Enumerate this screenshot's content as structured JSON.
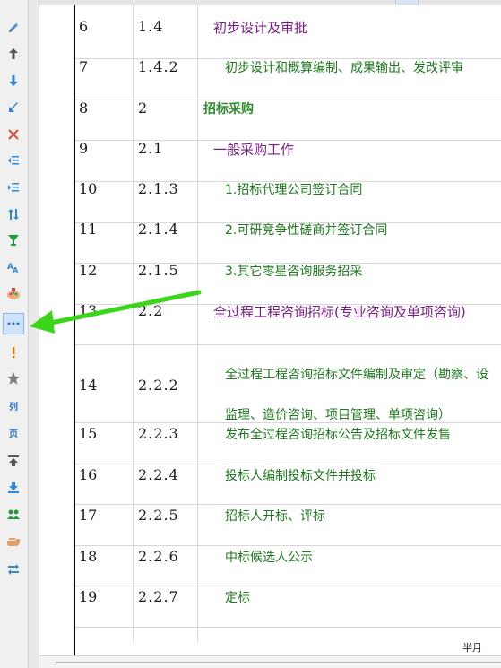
{
  "colors": {
    "summary_green": "#2e8b2e",
    "phase_purple": "#7a1e86",
    "task_green": "#1e7a1e",
    "annotation_arrow": "#3ad61a"
  },
  "toolbar": [
    {
      "name": "edit-pencil-icon"
    },
    {
      "name": "move-up-icon"
    },
    {
      "name": "move-down-icon"
    },
    {
      "name": "indent-arrow-icon"
    },
    {
      "name": "delete-icon"
    },
    {
      "name": "outdent-icon"
    },
    {
      "name": "indent-icon"
    },
    {
      "name": "swap-vertical-icon"
    },
    {
      "name": "filter-cup-icon"
    },
    {
      "name": "font-size-icon"
    },
    {
      "name": "palette-icon"
    },
    {
      "name": "more-dots-icon"
    },
    {
      "name": "exclamation-icon"
    },
    {
      "name": "star-icon"
    },
    {
      "name": "column-icon",
      "text": "列"
    },
    {
      "name": "page-icon",
      "text": "页"
    },
    {
      "name": "move-to-top-icon"
    },
    {
      "name": "download-icon"
    },
    {
      "name": "users-icon"
    },
    {
      "name": "hand-point-icon"
    },
    {
      "name": "switch-icon"
    }
  ],
  "rows": [
    {
      "seq": "6",
      "wbs": "1.4",
      "name": "初步设计及审批",
      "kind": "phase"
    },
    {
      "seq": "7",
      "wbs": "1.4.2",
      "name": "初步设计和概算编制、成果输出、发改评审",
      "kind": "task"
    },
    {
      "seq": "8",
      "wbs": "2",
      "name": "招标采购",
      "kind": "summary"
    },
    {
      "seq": "9",
      "wbs": "2.1",
      "name": "一般采购工作",
      "kind": "phase"
    },
    {
      "seq": "10",
      "wbs": "2.1.3",
      "name": "1.招标代理公司签订合同",
      "kind": "task"
    },
    {
      "seq": "11",
      "wbs": "2.1.4",
      "name": "2.可研竞争性磋商并签订合同",
      "kind": "task"
    },
    {
      "seq": "12",
      "wbs": "2.1.5",
      "name": "3.其它零星咨询服务招采",
      "kind": "task"
    },
    {
      "seq": "13",
      "wbs": "2.2",
      "name": "全过程工程咨询招标(专业咨询及单项咨询)",
      "kind": "phase"
    },
    {
      "seq": "14",
      "wbs": "2.2.2",
      "name": "全过程工程咨询招标文件编制及审定（勘察、设",
      "name2": "监理、造价咨询、项目管理、单项咨询）",
      "kind": "task"
    },
    {
      "seq": "15",
      "wbs": "2.2.3",
      "name": "发布全过程咨询招标公告及招标文件发售",
      "kind": "task"
    },
    {
      "seq": "16",
      "wbs": "2.2.4",
      "name": "投标人编制投标文件并投标",
      "kind": "task"
    },
    {
      "seq": "17",
      "wbs": "2.2.5",
      "name": "招标人开标、评标",
      "kind": "task"
    },
    {
      "seq": "18",
      "wbs": "2.2.6",
      "name": "中标候选人公示",
      "kind": "task"
    },
    {
      "seq": "19",
      "wbs": "2.2.7",
      "name": "定标",
      "kind": "task"
    }
  ],
  "footer": {
    "label": "半月"
  }
}
